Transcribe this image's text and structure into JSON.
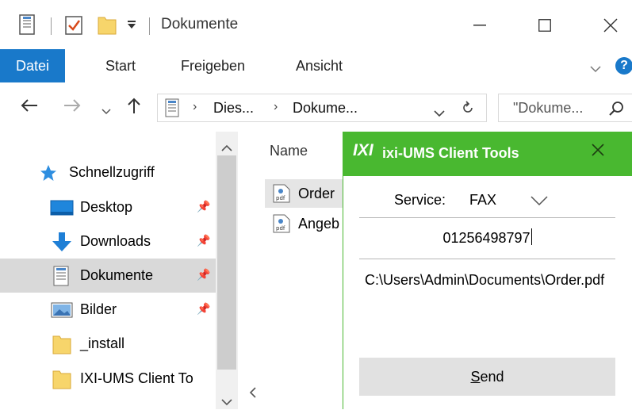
{
  "window": {
    "title": "Dokumente"
  },
  "ribbon": {
    "tabs": [
      "Datei",
      "Start",
      "Freigeben",
      "Ansicht"
    ],
    "help": "?"
  },
  "address": {
    "crumbs": [
      "Dies...",
      "Dokume..."
    ],
    "search_placeholder": "\"Dokume..."
  },
  "nav": {
    "items": [
      {
        "label": "Schnellzugriff",
        "icon": "star-icon"
      },
      {
        "label": "Desktop",
        "icon": "desktop-icon",
        "pinned": true
      },
      {
        "label": "Downloads",
        "icon": "download-arrow-icon",
        "pinned": true
      },
      {
        "label": "Dokumente",
        "icon": "documents-icon",
        "pinned": true,
        "selected": true
      },
      {
        "label": "Bilder",
        "icon": "pictures-icon",
        "pinned": true
      },
      {
        "label": "_install",
        "icon": "folder-icon"
      },
      {
        "label": "IXI-UMS Client To",
        "icon": "folder-icon"
      }
    ]
  },
  "filelist": {
    "column_name": "Name",
    "files": [
      {
        "label": "Order",
        "icon": "pdf-file-icon",
        "selected": true
      },
      {
        "label": "Angeb",
        "icon": "pdf-file-icon"
      }
    ]
  },
  "dialog": {
    "logo": "IXI",
    "title": "ixi-UMS Client Tools",
    "service_label": "Service:",
    "service_value": "FAX",
    "fax_number": "01256498797",
    "file_path": "C:\\Users\\Admin\\Documents\\Order.pdf",
    "send_mnemonic": "S",
    "send_rest": "end",
    "accent_color": "#49b830"
  }
}
